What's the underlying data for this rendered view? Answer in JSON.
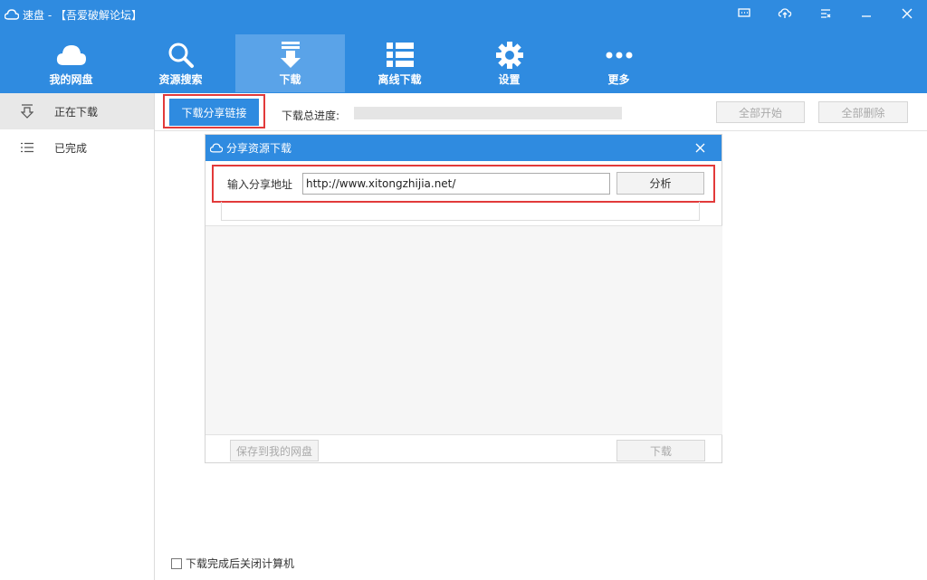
{
  "app": {
    "title": "速盘 - 【吾爱破解论坛】"
  },
  "nav": {
    "items": [
      {
        "label": "我的网盘",
        "icon": "cloud-icon"
      },
      {
        "label": "资源搜索",
        "icon": "search-icon"
      },
      {
        "label": "下载",
        "icon": "download-icon"
      },
      {
        "label": "离线下载",
        "icon": "list-icon"
      },
      {
        "label": "设置",
        "icon": "gear-icon"
      },
      {
        "label": "更多",
        "icon": "more-icon"
      }
    ],
    "active": "下载"
  },
  "sidebar": {
    "items": [
      {
        "label": "正在下载",
        "icon": "download-arrow-icon"
      },
      {
        "label": "已完成",
        "icon": "list-icon"
      }
    ]
  },
  "toolbar": {
    "share_link_button": "下载分享链接",
    "progress_label": "下载总进度:",
    "progress": 0,
    "start_all": "全部开始",
    "delete_all": "全部删除"
  },
  "dialog": {
    "title": "分享资源下载",
    "url_label": "输入分享地址",
    "url_value": "http://www.xitongzhijia.net/",
    "analyze_button": "分析",
    "save_button": "保存到我的网盘",
    "download_button": "下载"
  },
  "bottom": {
    "shutdown_option": "下载完成后关闭计算机"
  },
  "colors": {
    "primary": "#2f8be0",
    "nav_active": "#5aa3e8",
    "highlight": "#e23a3a"
  }
}
